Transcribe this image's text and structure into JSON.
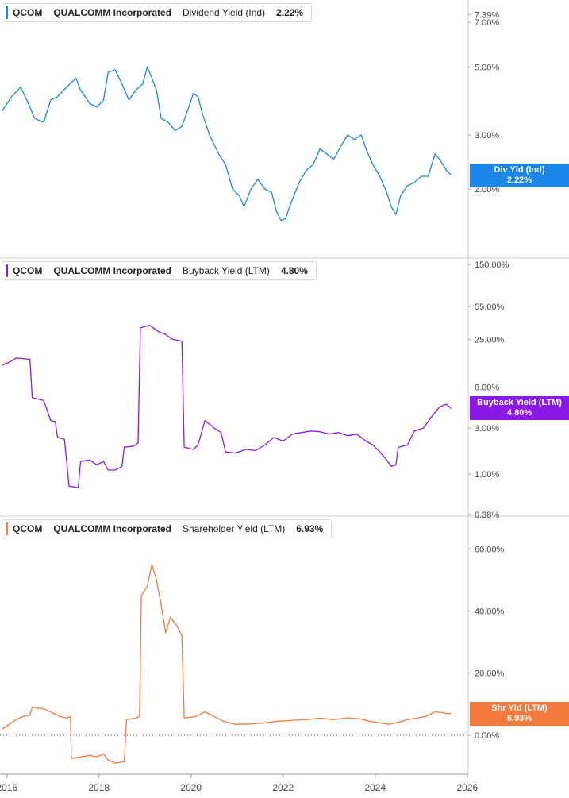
{
  "chart_data": [
    {
      "type": "line",
      "ticker": "QCOM",
      "company": "QUALCOMM Incorporated",
      "metric": "Dividend Yield (Ind)",
      "current_value": "2.22%",
      "badge_label": "Div Yld (Ind)",
      "badge_value": "2.22%",
      "color": "#1a86e8",
      "scale": "log",
      "ylim": [
        1.45,
        7.6
      ],
      "yticks": [
        {
          "v": 7.39,
          "label": "7.39%"
        },
        {
          "v": 7.0,
          "label": "7.00%"
        },
        {
          "v": 5.0,
          "label": "5.00%"
        },
        {
          "v": 3.0,
          "label": "3.00%"
        },
        {
          "v": 2.0,
          "label": "2.00%"
        }
      ],
      "series": [
        {
          "points": [
            [
              2015.9,
              3.6
            ],
            [
              2016.1,
              4.0
            ],
            [
              2016.3,
              4.3
            ],
            [
              2016.5,
              3.7
            ],
            [
              2016.6,
              3.4
            ],
            [
              2016.8,
              3.3
            ],
            [
              2016.95,
              3.9
            ],
            [
              2017.1,
              4.0
            ],
            [
              2017.3,
              4.3
            ],
            [
              2017.5,
              4.6
            ],
            [
              2017.6,
              4.2
            ],
            [
              2017.8,
              3.8
            ],
            [
              2017.95,
              3.7
            ],
            [
              2018.1,
              3.9
            ],
            [
              2018.2,
              4.8
            ],
            [
              2018.35,
              4.9
            ],
            [
              2018.5,
              4.4
            ],
            [
              2018.65,
              3.9
            ],
            [
              2018.8,
              4.2
            ],
            [
              2018.95,
              4.4
            ],
            [
              2019.05,
              5.0
            ],
            [
              2019.15,
              4.6
            ],
            [
              2019.25,
              4.2
            ],
            [
              2019.35,
              3.4
            ],
            [
              2019.5,
              3.3
            ],
            [
              2019.65,
              3.1
            ],
            [
              2019.8,
              3.2
            ],
            [
              2019.95,
              3.7
            ],
            [
              2020.05,
              4.1
            ],
            [
              2020.15,
              4.0
            ],
            [
              2020.25,
              3.5
            ],
            [
              2020.4,
              3.0
            ],
            [
              2020.6,
              2.6
            ],
            [
              2020.75,
              2.4
            ],
            [
              2020.9,
              2.0
            ],
            [
              2021.05,
              1.9
            ],
            [
              2021.15,
              1.75
            ],
            [
              2021.3,
              2.0
            ],
            [
              2021.45,
              2.15
            ],
            [
              2021.6,
              2.0
            ],
            [
              2021.75,
              1.95
            ],
            [
              2021.85,
              1.7
            ],
            [
              2021.95,
              1.58
            ],
            [
              2022.05,
              1.6
            ],
            [
              2022.2,
              1.85
            ],
            [
              2022.35,
              2.1
            ],
            [
              2022.5,
              2.3
            ],
            [
              2022.65,
              2.4
            ],
            [
              2022.8,
              2.7
            ],
            [
              2022.95,
              2.6
            ],
            [
              2023.1,
              2.5
            ],
            [
              2023.25,
              2.75
            ],
            [
              2023.4,
              3.0
            ],
            [
              2023.55,
              2.9
            ],
            [
              2023.7,
              3.0
            ],
            [
              2023.8,
              2.7
            ],
            [
              2023.95,
              2.4
            ],
            [
              2024.1,
              2.2
            ],
            [
              2024.25,
              1.95
            ],
            [
              2024.35,
              1.75
            ],
            [
              2024.45,
              1.65
            ],
            [
              2024.55,
              1.9
            ],
            [
              2024.7,
              2.05
            ],
            [
              2024.85,
              2.1
            ],
            [
              2025.0,
              2.2
            ],
            [
              2025.15,
              2.2
            ],
            [
              2025.3,
              2.6
            ],
            [
              2025.4,
              2.5
            ],
            [
              2025.55,
              2.3
            ],
            [
              2025.65,
              2.22
            ]
          ]
        }
      ]
    },
    {
      "type": "line",
      "ticker": "QCOM",
      "company": "QUALCOMM Incorporated",
      "metric": "Buyback Yield (LTM)",
      "current_value": "4.80%",
      "badge_label": "Buyback Yield (LTM)",
      "badge_value": "4.80%",
      "color": "#8a19e8",
      "scale": "log",
      "ylim": [
        0.38,
        150
      ],
      "yticks": [
        {
          "v": 150,
          "label": "150.00%"
        },
        {
          "v": 55,
          "label": "55.00%"
        },
        {
          "v": 25,
          "label": "25.00%"
        },
        {
          "v": 8,
          "label": "8.00%"
        },
        {
          "v": 3,
          "label": "3.00%"
        },
        {
          "v": 1,
          "label": "1.00%"
        },
        {
          "v": 0.38,
          "label": "0.38%"
        }
      ],
      "series": [
        {
          "points": [
            [
              2015.9,
              13.5
            ],
            [
              2016.05,
              14.5
            ],
            [
              2016.2,
              16.0
            ],
            [
              2016.35,
              15.8
            ],
            [
              2016.5,
              15.5
            ],
            [
              2016.55,
              6.2
            ],
            [
              2016.8,
              5.8
            ],
            [
              2016.95,
              3.6
            ],
            [
              2017.05,
              3.5
            ],
            [
              2017.1,
              2.4
            ],
            [
              2017.25,
              2.3
            ],
            [
              2017.35,
              0.75
            ],
            [
              2017.55,
              0.72
            ],
            [
              2017.6,
              1.35
            ],
            [
              2017.8,
              1.4
            ],
            [
              2017.95,
              1.25
            ],
            [
              2018.1,
              1.35
            ],
            [
              2018.2,
              1.1
            ],
            [
              2018.35,
              1.1
            ],
            [
              2018.5,
              1.2
            ],
            [
              2018.55,
              1.9
            ],
            [
              2018.75,
              1.95
            ],
            [
              2018.85,
              2.1
            ],
            [
              2018.9,
              33
            ],
            [
              2019.1,
              35
            ],
            [
              2019.3,
              30
            ],
            [
              2019.45,
              28
            ],
            [
              2019.6,
              25
            ],
            [
              2019.8,
              24
            ],
            [
              2019.85,
              1.9
            ],
            [
              2020.05,
              1.8
            ],
            [
              2020.15,
              2.0
            ],
            [
              2020.3,
              3.6
            ],
            [
              2020.5,
              3.0
            ],
            [
              2020.65,
              2.7
            ],
            [
              2020.75,
              1.7
            ],
            [
              2020.95,
              1.65
            ],
            [
              2021.2,
              1.8
            ],
            [
              2021.4,
              1.75
            ],
            [
              2021.6,
              2.0
            ],
            [
              2021.8,
              2.4
            ],
            [
              2022.0,
              2.2
            ],
            [
              2022.2,
              2.6
            ],
            [
              2022.4,
              2.7
            ],
            [
              2022.6,
              2.8
            ],
            [
              2022.8,
              2.75
            ],
            [
              2023.0,
              2.6
            ],
            [
              2023.2,
              2.7
            ],
            [
              2023.4,
              2.5
            ],
            [
              2023.6,
              2.6
            ],
            [
              2023.8,
              2.2
            ],
            [
              2023.95,
              2.0
            ],
            [
              2024.1,
              1.7
            ],
            [
              2024.25,
              1.4
            ],
            [
              2024.35,
              1.2
            ],
            [
              2024.45,
              1.25
            ],
            [
              2024.5,
              1.9
            ],
            [
              2024.7,
              2.0
            ],
            [
              2024.85,
              2.8
            ],
            [
              2025.05,
              3.0
            ],
            [
              2025.2,
              3.8
            ],
            [
              2025.4,
              5.0
            ],
            [
              2025.55,
              5.3
            ],
            [
              2025.65,
              4.8
            ]
          ]
        }
      ]
    },
    {
      "type": "line",
      "ticker": "QCOM",
      "company": "QUALCOMM Incorporated",
      "metric": "Shareholder Yield (LTM)",
      "current_value": "6.93%",
      "badge_label": "Shr Yld (LTM)",
      "badge_value": "6.93%",
      "color": "#f37a3c",
      "scale": "linear",
      "ylim": [
        -10,
        68
      ],
      "zero_line": true,
      "yticks": [
        {
          "v": 60,
          "label": "60.00%"
        },
        {
          "v": 40,
          "label": "40.00%"
        },
        {
          "v": 20,
          "label": "20.00%"
        },
        {
          "v": 0,
          "label": "0.00%"
        }
      ],
      "series": [
        {
          "points": [
            [
              2015.9,
              2.0
            ],
            [
              2016.05,
              3.5
            ],
            [
              2016.2,
              5.0
            ],
            [
              2016.35,
              6.0
            ],
            [
              2016.5,
              6.5
            ],
            [
              2016.55,
              9.0
            ],
            [
              2016.8,
              8.5
            ],
            [
              2016.95,
              7.5
            ],
            [
              2017.15,
              6.0
            ],
            [
              2017.3,
              5.5
            ],
            [
              2017.38,
              6.0
            ],
            [
              2017.4,
              -7.5
            ],
            [
              2017.6,
              -7.0
            ],
            [
              2017.8,
              -6.5
            ],
            [
              2017.95,
              -7.0
            ],
            [
              2018.1,
              -6.0
            ],
            [
              2018.2,
              -8.0
            ],
            [
              2018.35,
              -9.0
            ],
            [
              2018.55,
              -8.5
            ],
            [
              2018.6,
              5.0
            ],
            [
              2018.8,
              5.5
            ],
            [
              2018.88,
              6.0
            ],
            [
              2018.92,
              45
            ],
            [
              2019.05,
              48
            ],
            [
              2019.15,
              55
            ],
            [
              2019.25,
              50
            ],
            [
              2019.35,
              42
            ],
            [
              2019.45,
              33
            ],
            [
              2019.55,
              38
            ],
            [
              2019.7,
              35
            ],
            [
              2019.8,
              32
            ],
            [
              2019.85,
              5.5
            ],
            [
              2020.1,
              6.0
            ],
            [
              2020.3,
              7.5
            ],
            [
              2020.5,
              6.0
            ],
            [
              2020.7,
              4.5
            ],
            [
              2020.95,
              3.5
            ],
            [
              2021.3,
              3.6
            ],
            [
              2021.6,
              4.0
            ],
            [
              2021.9,
              4.5
            ],
            [
              2022.2,
              4.8
            ],
            [
              2022.5,
              5.0
            ],
            [
              2022.8,
              5.5
            ],
            [
              2023.1,
              5.0
            ],
            [
              2023.4,
              5.6
            ],
            [
              2023.7,
              5.2
            ],
            [
              2023.9,
              4.4
            ],
            [
              2024.1,
              4.0
            ],
            [
              2024.3,
              3.5
            ],
            [
              2024.5,
              4.2
            ],
            [
              2024.7,
              5.0
            ],
            [
              2024.9,
              5.5
            ],
            [
              2025.1,
              6.0
            ],
            [
              2025.3,
              7.5
            ],
            [
              2025.45,
              7.3
            ],
            [
              2025.55,
              7.0
            ],
            [
              2025.65,
              6.93
            ]
          ]
        }
      ]
    }
  ],
  "x_axis": {
    "range": [
      2015.85,
      2026.02
    ],
    "ticks": [
      {
        "v": 2016,
        "label": "2016"
      },
      {
        "v": 2018,
        "label": "2018"
      },
      {
        "v": 2020,
        "label": "2020"
      },
      {
        "v": 2022,
        "label": "2022"
      },
      {
        "v": 2024,
        "label": "2024"
      },
      {
        "v": 2026,
        "label": "2026"
      }
    ]
  }
}
